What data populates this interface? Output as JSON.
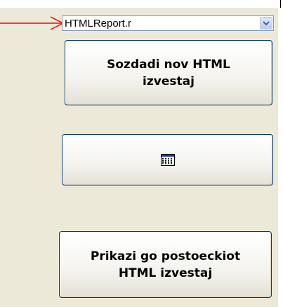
{
  "dropdown": {
    "selected_value": "HTMLReport.r",
    "arrow_icon": "chevron-down-icon"
  },
  "buttons": {
    "create_label": "Sozdadi nov HTML\nizvestaj",
    "calendar_icon": "calendar-icon",
    "show_label": "Prikazi go postoeckiot\nHTML izvestaj"
  },
  "annotation": {
    "arrow_color": "#ff0000"
  }
}
